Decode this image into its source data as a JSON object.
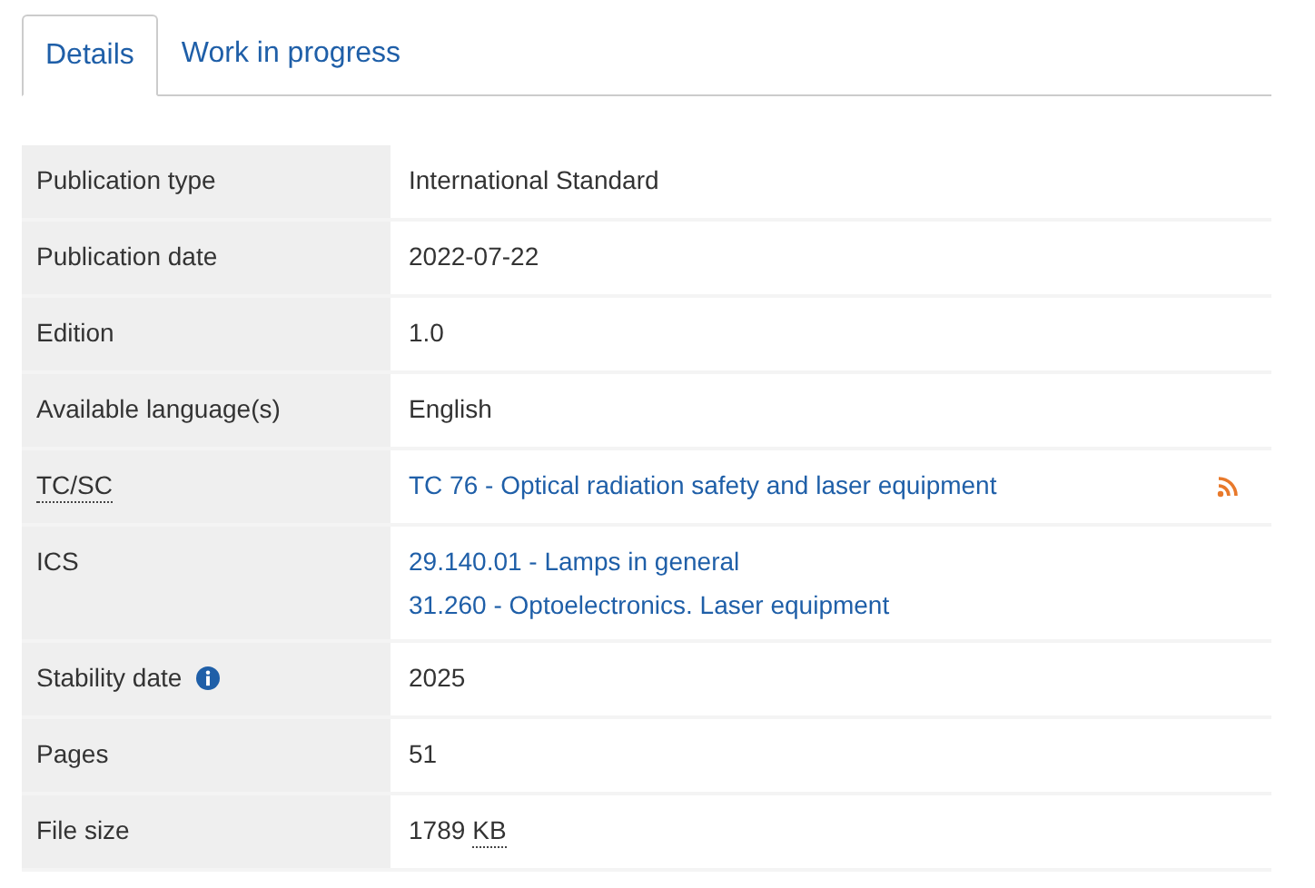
{
  "tabs": [
    {
      "label": "Details",
      "selected": true
    },
    {
      "label": "Work in progress",
      "selected": false
    }
  ],
  "table": {
    "rows": [
      {
        "label": {
          "text": "Publication type",
          "kind": "text"
        },
        "lines": [
          [
            {
              "text": "International Standard",
              "kind": "text"
            }
          ]
        ]
      },
      {
        "label": {
          "text": "Publication date",
          "kind": "text"
        },
        "lines": [
          [
            {
              "text": "2022-07-22",
              "kind": "text"
            }
          ]
        ]
      },
      {
        "label": {
          "text": "Edition",
          "kind": "text"
        },
        "lines": [
          [
            {
              "text": "1.0",
              "kind": "text"
            }
          ]
        ]
      },
      {
        "label": {
          "text": "Available language(s)",
          "kind": "text"
        },
        "lines": [
          [
            {
              "text": "English",
              "kind": "text"
            }
          ]
        ]
      },
      {
        "label": {
          "text": "TC/SC",
          "kind": "abbr"
        },
        "lines": [
          [
            {
              "text": "TC 76 - Optical radiation safety and laser equipment",
              "kind": "link"
            }
          ]
        ],
        "rss_icon": true
      },
      {
        "label": {
          "text": "ICS",
          "kind": "text"
        },
        "lines": [
          [
            {
              "text": "29.140.01 - Lamps in general",
              "kind": "link"
            }
          ],
          [
            {
              "text": "31.260 - Optoelectronics. Laser equipment",
              "kind": "link"
            }
          ]
        ]
      },
      {
        "label": {
          "text": "Stability date",
          "kind": "text"
        },
        "info_icon": true,
        "lines": [
          [
            {
              "text": "2025",
              "kind": "text"
            }
          ]
        ]
      },
      {
        "label": {
          "text": "Pages",
          "kind": "text"
        },
        "lines": [
          [
            {
              "text": "51",
              "kind": "text"
            }
          ]
        ]
      },
      {
        "label": {
          "text": "File size",
          "kind": "text"
        },
        "lines": [
          [
            {
              "text": "1789",
              "kind": "text"
            },
            {
              "text": "KB",
              "kind": "abbr"
            }
          ]
        ]
      }
    ]
  }
}
